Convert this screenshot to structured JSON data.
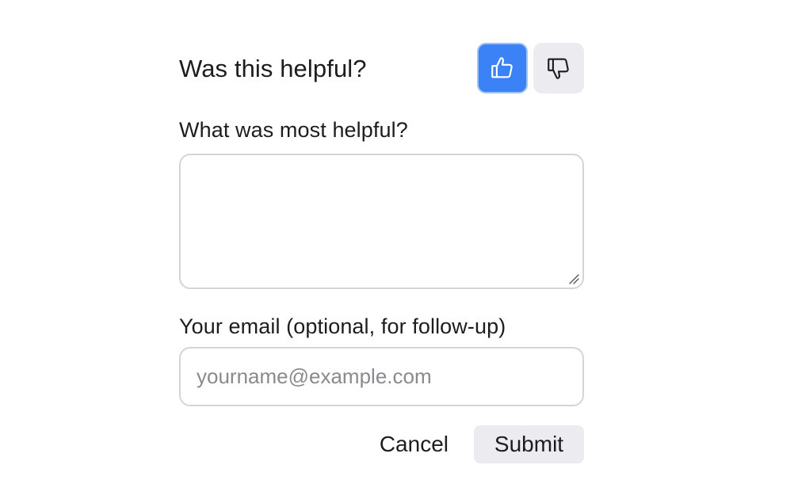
{
  "feedback": {
    "question": "Was this helpful?",
    "thumbs_up_icon": "thumbs-up-icon",
    "thumbs_down_icon": "thumbs-down-icon",
    "selected_vote": "up",
    "accent_color": "#3b82f6",
    "helpful_label": "What was most helpful?",
    "helpful_value": "",
    "email_label": "Your email (optional, for follow-up)",
    "email_value": "",
    "email_placeholder": "yourname@example.com",
    "cancel_label": "Cancel",
    "submit_label": "Submit"
  }
}
